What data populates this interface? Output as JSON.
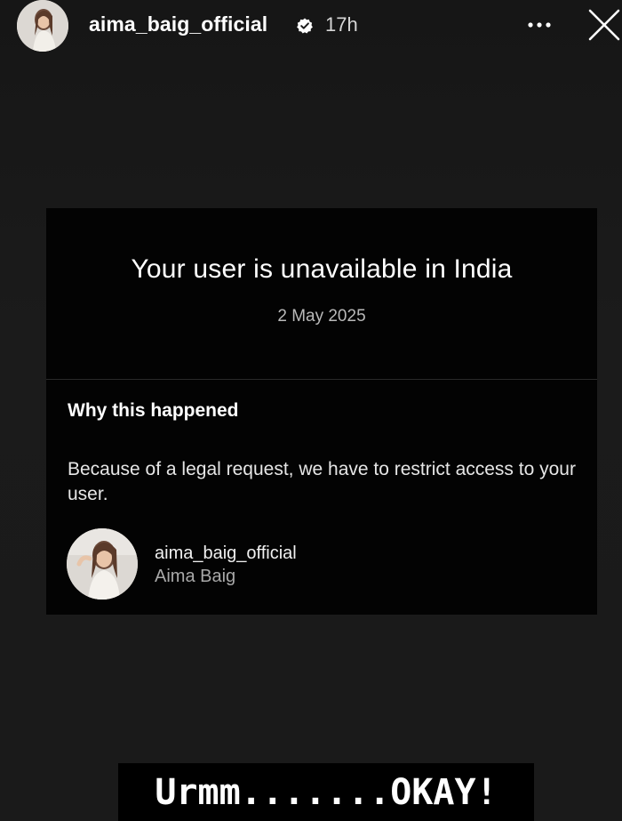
{
  "header": {
    "username": "aima_baig_official",
    "verified_icon": "verified-badge-icon",
    "timestamp": "17h",
    "more_icon": "more-options-icon",
    "close_icon": "close-icon"
  },
  "notice": {
    "title": "Your user is unavailable in India",
    "date": "2 May 2025",
    "why_heading": "Why this happened",
    "why_body": "Because of a legal request, we have to restrict access to your user.",
    "account": {
      "username": "aima_baig_official",
      "display_name": "Aima Baig"
    }
  },
  "caption": {
    "text": "Urmm.......OKAY!"
  },
  "colors": {
    "background": "#191919",
    "card": "#030303",
    "text": "#ffffff",
    "muted_text": "#a9a9a9"
  }
}
